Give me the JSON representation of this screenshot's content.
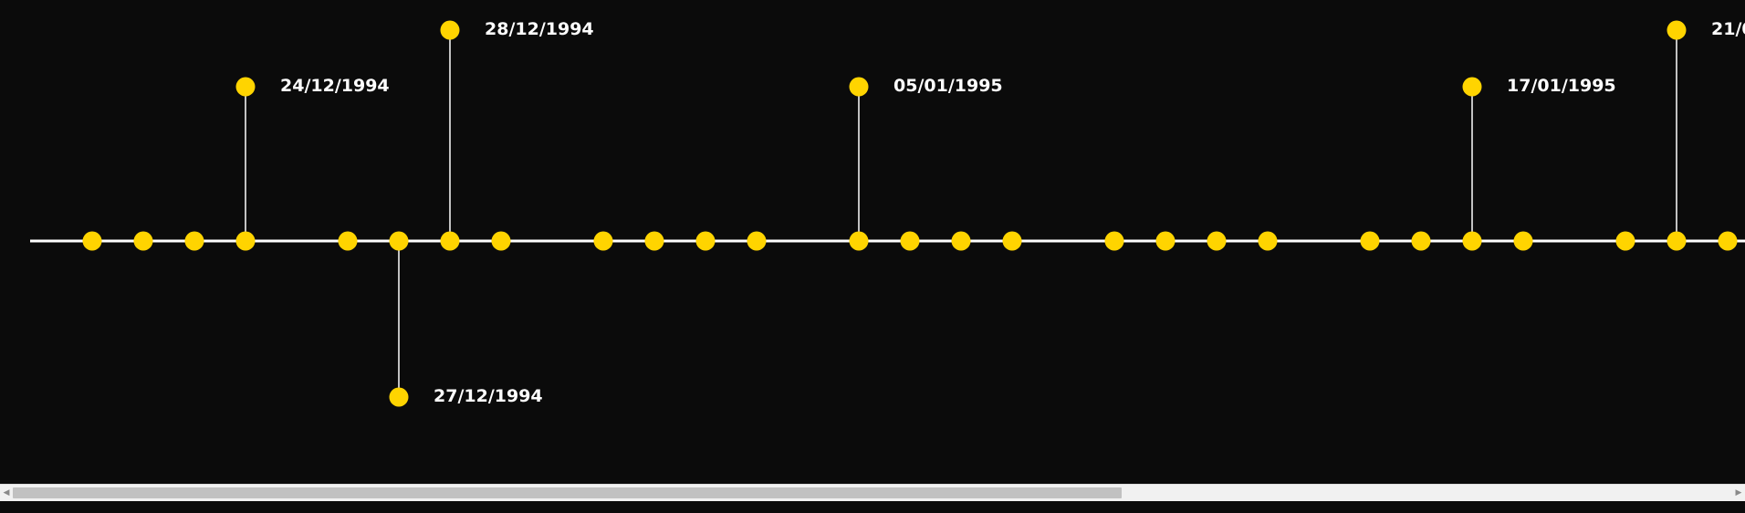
{
  "colors": {
    "background": "#0b0b0b",
    "axis": "#ffffff",
    "marker": "#ffd400",
    "connector": "#ffffff",
    "label": "#ffffff"
  },
  "events": [
    {
      "label": "24/12/1994"
    },
    {
      "label": "28/12/1994"
    },
    {
      "label": "27/12/1994"
    },
    {
      "label": "05/01/1995"
    },
    {
      "label": "17/01/1995"
    },
    {
      "label": "21/0"
    }
  ],
  "scrollbar": {
    "thumb_fraction": 0.645,
    "left_arrow_icon": "triangle-left-icon",
    "right_arrow_icon": "triangle-right-icon"
  }
}
